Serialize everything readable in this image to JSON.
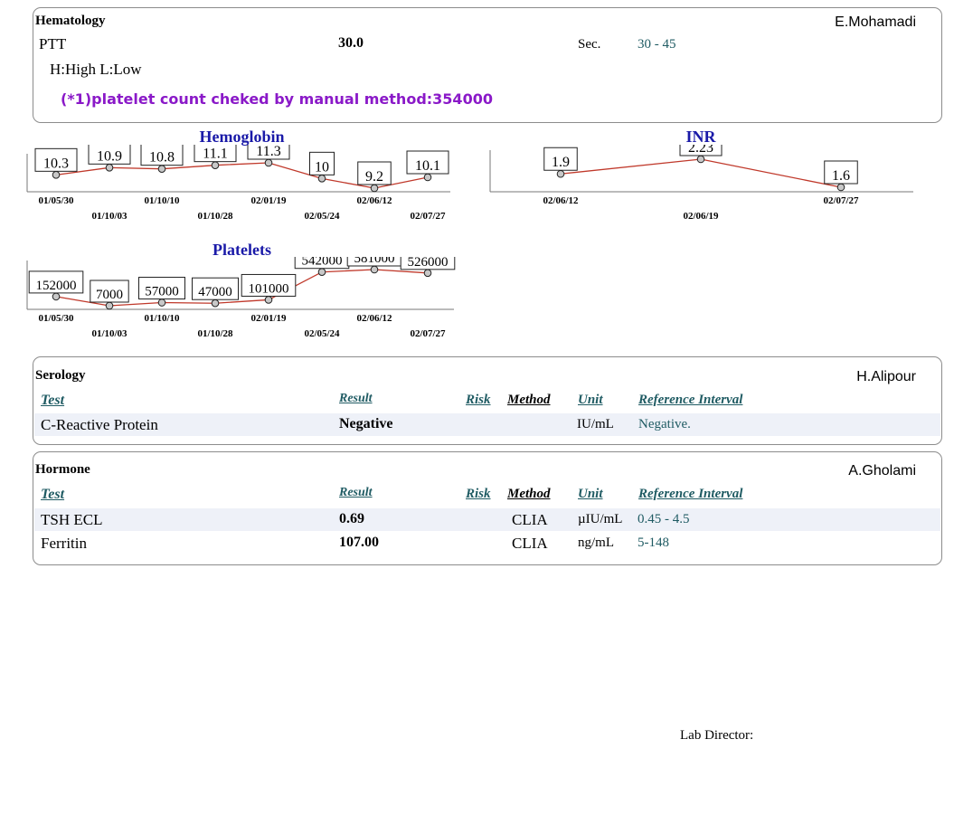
{
  "hematology": {
    "title": "Hematology",
    "doctor": "E.Mohamadi",
    "ptt": {
      "test": "PTT",
      "result": "30.0",
      "unit": "Sec.",
      "range": "30 - 45"
    },
    "legend": "H:High L:Low",
    "note": "(*1)platelet count cheked by manual method:354000"
  },
  "chart_data": [
    {
      "type": "line",
      "title": "Hemoglobin",
      "categories": [
        "01/05/30",
        "01/10/03",
        "01/10/10",
        "01/10/28",
        "02/01/19",
        "02/05/24",
        "02/06/12",
        "02/07/27"
      ],
      "values": [
        10.3,
        10.9,
        10.8,
        11.1,
        11.3,
        10,
        9.2,
        10.1
      ],
      "labels": [
        "10.3",
        "10.9",
        "10.8",
        "11.1",
        "11.3",
        "10",
        "9.2",
        "10.1"
      ],
      "line_color": "#c0392b"
    },
    {
      "type": "line",
      "title": "INR",
      "categories": [
        "02/06/12",
        "02/06/19",
        "02/07/27"
      ],
      "values": [
        1.9,
        2.23,
        1.6
      ],
      "labels": [
        "1.9",
        "2.23",
        "1.6"
      ],
      "line_color": "#c0392b"
    },
    {
      "type": "line",
      "title": "Platelets",
      "categories": [
        "01/05/30",
        "01/10/03",
        "01/10/10",
        "01/10/28",
        "02/01/19",
        "02/05/24",
        "02/06/12",
        "02/07/27"
      ],
      "values": [
        152000,
        7000,
        57000,
        47000,
        101000,
        542000,
        581000,
        526000
      ],
      "labels": [
        "152000",
        "7000",
        "57000",
        "47000",
        "101000",
        "542000",
        "581000",
        "526000"
      ],
      "line_color": "#c0392b"
    }
  ],
  "serology": {
    "title": "Serology",
    "doctor": "H.Alipour",
    "headers": {
      "test": "Test",
      "result": "Result",
      "risk": "Risk",
      "method": "Method",
      "unit": "Unit",
      "ref": "Reference Interval"
    },
    "rows": [
      {
        "test": "C-Reactive Protein",
        "result": "Negative",
        "method": "",
        "unit": "IU/mL",
        "ref": "Negative."
      }
    ]
  },
  "hormone": {
    "title": "Hormone",
    "doctor": "A.Gholami",
    "headers": {
      "test": "Test",
      "result": "Result",
      "risk": "Risk",
      "method": "Method",
      "unit": "Unit",
      "ref": "Reference Interval"
    },
    "rows": [
      {
        "test": "TSH ECL",
        "result": "0.69",
        "method": "CLIA",
        "unit": "µIU/mL",
        "ref": "0.45 - 4.5"
      },
      {
        "test": "Ferritin",
        "result": "107.00",
        "method": "CLIA",
        "unit": "ng/mL",
        "ref": "5-148"
      }
    ]
  },
  "footer": {
    "lab_director": "Lab Director:"
  }
}
